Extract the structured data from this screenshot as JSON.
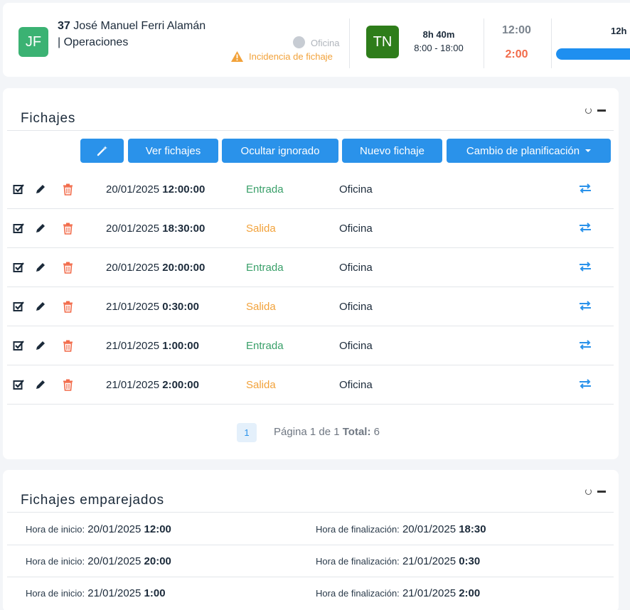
{
  "employee": {
    "initials": "JF",
    "avatar_color": "#3bb273",
    "number": "37",
    "name": "José Manuel Ferri Alamán",
    "department": "| Operaciones",
    "location_status": "Oficina",
    "warning": "Incidencia de fichaje"
  },
  "shift": {
    "initials": "TN",
    "avatar_color": "#2e7d1a",
    "hours": "8h 40m",
    "range": "8:00 - 18:00",
    "time_main": "12:00",
    "time_diff": "2:00",
    "progress_label": "12h",
    "progress_fraction": 1.0
  },
  "fichajes": {
    "title": "Fichajes",
    "buttons": {
      "magic_icon": "magic-wand-icon",
      "view": "Ver fichajes",
      "hide": "Ocultar ignorado",
      "new": "Nuevo fichaje",
      "plan_change": "Cambio de planificación"
    },
    "rows": [
      {
        "date": "20/01/2025",
        "time": "12:00:00",
        "type": "Entrada",
        "location": "Oficina"
      },
      {
        "date": "20/01/2025",
        "time": "18:30:00",
        "type": "Salida",
        "location": "Oficina"
      },
      {
        "date": "20/01/2025",
        "time": "20:00:00",
        "type": "Entrada",
        "location": "Oficina"
      },
      {
        "date": "21/01/2025",
        "time": "0:30:00",
        "type": "Salida",
        "location": "Oficina"
      },
      {
        "date": "21/01/2025",
        "time": "1:00:00",
        "type": "Entrada",
        "location": "Oficina"
      },
      {
        "date": "21/01/2025",
        "time": "2:00:00",
        "type": "Salida",
        "location": "Oficina"
      }
    ],
    "pagination": {
      "current": "1",
      "info": "Página 1 de 1",
      "total_label": "Total:",
      "total": "6"
    }
  },
  "emparejados": {
    "title": "Fichajes emparejados",
    "start_label": "Hora de inicio:",
    "end_label": "Hora de finalización:",
    "pairs": [
      {
        "start_date": "20/01/2025",
        "start_time": "12:00",
        "end_date": "20/01/2025",
        "end_time": "18:30"
      },
      {
        "start_date": "20/01/2025",
        "start_time": "20:00",
        "end_date": "21/01/2025",
        "end_time": "0:30"
      },
      {
        "start_date": "21/01/2025",
        "start_time": "1:00",
        "end_date": "21/01/2025",
        "end_time": "2:00"
      }
    ]
  },
  "colors": {
    "primary": "#2a92ea",
    "entrada": "#3aa06a",
    "salida": "#f2a23a",
    "danger": "#f26b4a"
  }
}
